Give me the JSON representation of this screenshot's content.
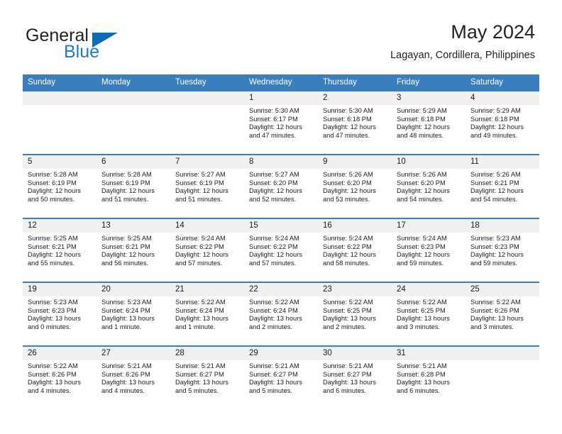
{
  "brand": {
    "word1": "General",
    "word2": "Blue",
    "accent_color": "#0b6cb3"
  },
  "header": {
    "title": "May 2024",
    "location": "Lagayan, Cordillera, Philippines"
  },
  "calendar": {
    "header_bg": "#3b7ec0",
    "daynum_bg": "#f0f0f0",
    "weekdays": [
      "Sunday",
      "Monday",
      "Tuesday",
      "Wednesday",
      "Thursday",
      "Friday",
      "Saturday"
    ],
    "labels": {
      "sunrise": "Sunrise:",
      "sunset": "Sunset:",
      "daylight": "Daylight:"
    },
    "weeks": [
      [
        {
          "day": "",
          "sunrise": "",
          "sunset": "",
          "daylight_line1": "",
          "daylight_line2": ""
        },
        {
          "day": "",
          "sunrise": "",
          "sunset": "",
          "daylight_line1": "",
          "daylight_line2": ""
        },
        {
          "day": "",
          "sunrise": "",
          "sunset": "",
          "daylight_line1": "",
          "daylight_line2": ""
        },
        {
          "day": "1",
          "sunrise": "Sunrise: 5:30 AM",
          "sunset": "Sunset: 6:17 PM",
          "daylight_line1": "Daylight: 12 hours",
          "daylight_line2": "and 47 minutes."
        },
        {
          "day": "2",
          "sunrise": "Sunrise: 5:30 AM",
          "sunset": "Sunset: 6:18 PM",
          "daylight_line1": "Daylight: 12 hours",
          "daylight_line2": "and 47 minutes."
        },
        {
          "day": "3",
          "sunrise": "Sunrise: 5:29 AM",
          "sunset": "Sunset: 6:18 PM",
          "daylight_line1": "Daylight: 12 hours",
          "daylight_line2": "and 48 minutes."
        },
        {
          "day": "4",
          "sunrise": "Sunrise: 5:29 AM",
          "sunset": "Sunset: 6:18 PM",
          "daylight_line1": "Daylight: 12 hours",
          "daylight_line2": "and 49 minutes."
        }
      ],
      [
        {
          "day": "5",
          "sunrise": "Sunrise: 5:28 AM",
          "sunset": "Sunset: 6:19 PM",
          "daylight_line1": "Daylight: 12 hours",
          "daylight_line2": "and 50 minutes."
        },
        {
          "day": "6",
          "sunrise": "Sunrise: 5:28 AM",
          "sunset": "Sunset: 6:19 PM",
          "daylight_line1": "Daylight: 12 hours",
          "daylight_line2": "and 51 minutes."
        },
        {
          "day": "7",
          "sunrise": "Sunrise: 5:27 AM",
          "sunset": "Sunset: 6:19 PM",
          "daylight_line1": "Daylight: 12 hours",
          "daylight_line2": "and 51 minutes."
        },
        {
          "day": "8",
          "sunrise": "Sunrise: 5:27 AM",
          "sunset": "Sunset: 6:20 PM",
          "daylight_line1": "Daylight: 12 hours",
          "daylight_line2": "and 52 minutes."
        },
        {
          "day": "9",
          "sunrise": "Sunrise: 5:26 AM",
          "sunset": "Sunset: 6:20 PM",
          "daylight_line1": "Daylight: 12 hours",
          "daylight_line2": "and 53 minutes."
        },
        {
          "day": "10",
          "sunrise": "Sunrise: 5:26 AM",
          "sunset": "Sunset: 6:20 PM",
          "daylight_line1": "Daylight: 12 hours",
          "daylight_line2": "and 54 minutes."
        },
        {
          "day": "11",
          "sunrise": "Sunrise: 5:26 AM",
          "sunset": "Sunset: 6:21 PM",
          "daylight_line1": "Daylight: 12 hours",
          "daylight_line2": "and 54 minutes."
        }
      ],
      [
        {
          "day": "12",
          "sunrise": "Sunrise: 5:25 AM",
          "sunset": "Sunset: 6:21 PM",
          "daylight_line1": "Daylight: 12 hours",
          "daylight_line2": "and 55 minutes."
        },
        {
          "day": "13",
          "sunrise": "Sunrise: 5:25 AM",
          "sunset": "Sunset: 6:21 PM",
          "daylight_line1": "Daylight: 12 hours",
          "daylight_line2": "and 56 minutes."
        },
        {
          "day": "14",
          "sunrise": "Sunrise: 5:24 AM",
          "sunset": "Sunset: 6:22 PM",
          "daylight_line1": "Daylight: 12 hours",
          "daylight_line2": "and 57 minutes."
        },
        {
          "day": "15",
          "sunrise": "Sunrise: 5:24 AM",
          "sunset": "Sunset: 6:22 PM",
          "daylight_line1": "Daylight: 12 hours",
          "daylight_line2": "and 57 minutes."
        },
        {
          "day": "16",
          "sunrise": "Sunrise: 5:24 AM",
          "sunset": "Sunset: 6:22 PM",
          "daylight_line1": "Daylight: 12 hours",
          "daylight_line2": "and 58 minutes."
        },
        {
          "day": "17",
          "sunrise": "Sunrise: 5:24 AM",
          "sunset": "Sunset: 6:23 PM",
          "daylight_line1": "Daylight: 12 hours",
          "daylight_line2": "and 59 minutes."
        },
        {
          "day": "18",
          "sunrise": "Sunrise: 5:23 AM",
          "sunset": "Sunset: 6:23 PM",
          "daylight_line1": "Daylight: 12 hours",
          "daylight_line2": "and 59 minutes."
        }
      ],
      [
        {
          "day": "19",
          "sunrise": "Sunrise: 5:23 AM",
          "sunset": "Sunset: 6:23 PM",
          "daylight_line1": "Daylight: 13 hours",
          "daylight_line2": "and 0 minutes."
        },
        {
          "day": "20",
          "sunrise": "Sunrise: 5:23 AM",
          "sunset": "Sunset: 6:24 PM",
          "daylight_line1": "Daylight: 13 hours",
          "daylight_line2": "and 1 minute."
        },
        {
          "day": "21",
          "sunrise": "Sunrise: 5:22 AM",
          "sunset": "Sunset: 6:24 PM",
          "daylight_line1": "Daylight: 13 hours",
          "daylight_line2": "and 1 minute."
        },
        {
          "day": "22",
          "sunrise": "Sunrise: 5:22 AM",
          "sunset": "Sunset: 6:24 PM",
          "daylight_line1": "Daylight: 13 hours",
          "daylight_line2": "and 2 minutes."
        },
        {
          "day": "23",
          "sunrise": "Sunrise: 5:22 AM",
          "sunset": "Sunset: 6:25 PM",
          "daylight_line1": "Daylight: 13 hours",
          "daylight_line2": "and 2 minutes."
        },
        {
          "day": "24",
          "sunrise": "Sunrise: 5:22 AM",
          "sunset": "Sunset: 6:25 PM",
          "daylight_line1": "Daylight: 13 hours",
          "daylight_line2": "and 3 minutes."
        },
        {
          "day": "25",
          "sunrise": "Sunrise: 5:22 AM",
          "sunset": "Sunset: 6:26 PM",
          "daylight_line1": "Daylight: 13 hours",
          "daylight_line2": "and 3 minutes."
        }
      ],
      [
        {
          "day": "26",
          "sunrise": "Sunrise: 5:22 AM",
          "sunset": "Sunset: 6:26 PM",
          "daylight_line1": "Daylight: 13 hours",
          "daylight_line2": "and 4 minutes."
        },
        {
          "day": "27",
          "sunrise": "Sunrise: 5:21 AM",
          "sunset": "Sunset: 6:26 PM",
          "daylight_line1": "Daylight: 13 hours",
          "daylight_line2": "and 4 minutes."
        },
        {
          "day": "28",
          "sunrise": "Sunrise: 5:21 AM",
          "sunset": "Sunset: 6:27 PM",
          "daylight_line1": "Daylight: 13 hours",
          "daylight_line2": "and 5 minutes."
        },
        {
          "day": "29",
          "sunrise": "Sunrise: 5:21 AM",
          "sunset": "Sunset: 6:27 PM",
          "daylight_line1": "Daylight: 13 hours",
          "daylight_line2": "and 5 minutes."
        },
        {
          "day": "30",
          "sunrise": "Sunrise: 5:21 AM",
          "sunset": "Sunset: 6:27 PM",
          "daylight_line1": "Daylight: 13 hours",
          "daylight_line2": "and 6 minutes."
        },
        {
          "day": "31",
          "sunrise": "Sunrise: 5:21 AM",
          "sunset": "Sunset: 6:28 PM",
          "daylight_line1": "Daylight: 13 hours",
          "daylight_line2": "and 6 minutes."
        },
        {
          "day": "",
          "sunrise": "",
          "sunset": "",
          "daylight_line1": "",
          "daylight_line2": ""
        }
      ]
    ]
  }
}
